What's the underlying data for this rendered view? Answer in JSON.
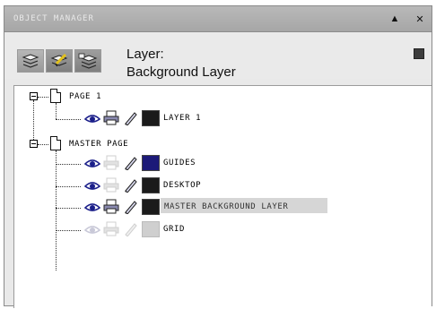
{
  "window": {
    "title": "OBJECT MANAGER",
    "collapse_glyph": "▲",
    "close_glyph": "✕"
  },
  "header": {
    "layer_prefix": "Layer:",
    "layer_name": "Background Layer",
    "tools": [
      {
        "name": "show-object-properties-icon"
      },
      {
        "name": "edit-across-layers-icon"
      },
      {
        "name": "layer-manager-view-icon"
      }
    ],
    "flyout_icon": "flyout-menu-icon"
  },
  "tree": {
    "pages": [
      {
        "label": "PAGE 1",
        "layers": [
          {
            "label": "LAYER 1",
            "color": "#1b1b1b",
            "visible": true,
            "printable": true,
            "editable": true
          }
        ]
      },
      {
        "label": "MASTER PAGE",
        "layers": [
          {
            "label": "GUIDES",
            "color": "#1c1a78",
            "visible": true,
            "printable": false,
            "editable": true
          },
          {
            "label": "DESKTOP",
            "color": "#1b1b1b",
            "visible": true,
            "printable": false,
            "editable": true
          },
          {
            "label": "MASTER BACKGROUND LAYER",
            "color": "#1b1b1b",
            "visible": true,
            "printable": true,
            "editable": true,
            "selected": true
          },
          {
            "label": "GRID",
            "color": "#cfcfcf",
            "visible": false,
            "printable": false,
            "editable": false
          }
        ]
      }
    ]
  },
  "colors": {
    "selection": "#d6d6d6",
    "title_bar": "#a9a9a9"
  }
}
